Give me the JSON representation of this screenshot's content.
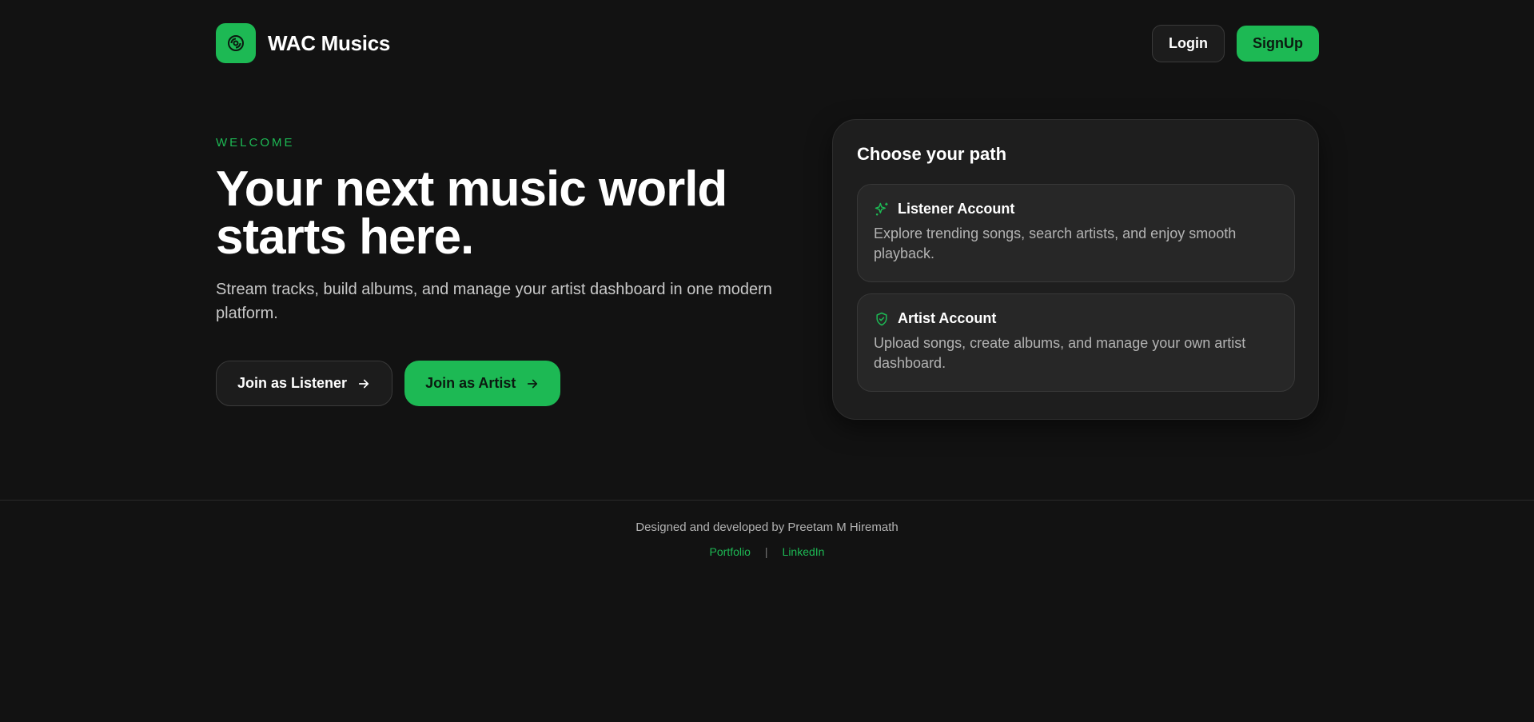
{
  "header": {
    "brand_name": "WAC Musics",
    "login_label": "Login",
    "signup_label": "SignUp"
  },
  "hero": {
    "eyebrow": "WELCOME",
    "headline_line1": "Your next music world",
    "headline_line2": "starts here.",
    "subtext": "Stream tracks, build albums, and manage your artist dashboard in one modern platform.",
    "listener_button": "Join as Listener",
    "artist_button": "Join as Artist"
  },
  "path_card": {
    "title": "Choose your path",
    "options": [
      {
        "title": "Listener Account",
        "description": "Explore trending songs, search artists, and enjoy smooth playback.",
        "icon": "sparkles-icon"
      },
      {
        "title": "Artist Account",
        "description": "Upload songs, create albums, and manage your own artist dashboard.",
        "icon": "shield-check-icon"
      }
    ]
  },
  "footer": {
    "credit": "Designed and developed by Preetam M Hiremath",
    "links": [
      "Portfolio",
      "LinkedIn"
    ],
    "separator": "|"
  },
  "colors": {
    "background": "#121212",
    "accent": "#1db954",
    "card": "#1e1e1e",
    "muted_text": "#b3b3b3"
  }
}
